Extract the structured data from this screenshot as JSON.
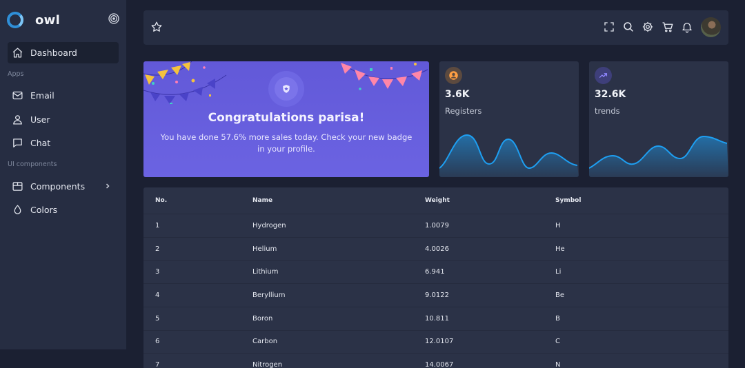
{
  "app": {
    "name": "owl"
  },
  "sidebar": {
    "items": [
      {
        "label": "Dashboard",
        "icon": "home-icon",
        "active": true
      },
      {
        "label": "Email",
        "icon": "mail-icon"
      },
      {
        "label": "User",
        "icon": "user-icon"
      },
      {
        "label": "Chat",
        "icon": "chat-icon"
      },
      {
        "label": "Components",
        "icon": "package-icon"
      },
      {
        "label": "Colors",
        "icon": "droplet-icon"
      }
    ],
    "sections": {
      "apps": "Apps",
      "ui": "UI components"
    }
  },
  "header": {
    "icons": [
      "star-icon",
      "fullscreen-icon",
      "search-icon",
      "settings-icon",
      "cart-icon",
      "bell-icon",
      "avatar"
    ]
  },
  "congrats": {
    "title": "Congratulations parisa!",
    "text": "You have done 57.6% more sales today. Check your new badge in your profile."
  },
  "stats": [
    {
      "value": "3.6K",
      "label": "Registers",
      "icon": "user-circle-icon",
      "color": "#ff9f43"
    },
    {
      "value": "32.6K",
      "label": "trends",
      "icon": "trending-up-icon",
      "color": "#7367f0"
    }
  ],
  "table": {
    "columns": [
      "No.",
      "Name",
      "Weight",
      "Symbol"
    ],
    "rows": [
      [
        "1",
        "Hydrogen",
        "1.0079",
        "H"
      ],
      [
        "2",
        "Helium",
        "4.0026",
        "He"
      ],
      [
        "3",
        "Lithium",
        "6.941",
        "Li"
      ],
      [
        "4",
        "Beryllium",
        "9.0122",
        "Be"
      ],
      [
        "5",
        "Boron",
        "10.811",
        "B"
      ],
      [
        "6",
        "Carbon",
        "12.0107",
        "C"
      ],
      [
        "7",
        "Nitrogen",
        "14.0067",
        "N"
      ]
    ]
  },
  "colors": {
    "accent": "#7367f0",
    "wave": "#1e9ff2",
    "sidebar": "#262d42",
    "card": "#2b3247"
  }
}
